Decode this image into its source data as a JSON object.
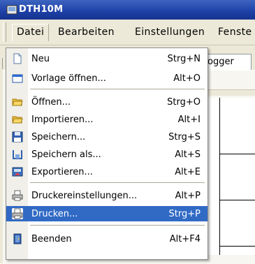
{
  "window": {
    "title": "DTH10M"
  },
  "menubar": {
    "items": [
      {
        "label": "Datei"
      },
      {
        "label": "Bearbeiten"
      },
      {
        "label": "Einstellungen"
      },
      {
        "label": "Fenste"
      }
    ]
  },
  "background": {
    "tab_label": "ogger"
  },
  "datei_menu": {
    "items": [
      {
        "label": "Neu",
        "shortcut": "Strg+N",
        "icon": "new-document-icon"
      },
      {
        "label": "Vorlage öffnen...",
        "shortcut": "Alt+O",
        "icon": "template-icon"
      },
      {
        "label": "Öffnen...",
        "shortcut": "Strg+O",
        "icon": "open-folder-icon"
      },
      {
        "label": "Importieren...",
        "shortcut": "Alt+I",
        "icon": "import-folder-icon"
      },
      {
        "label": "Speichern...",
        "shortcut": "Strg+S",
        "icon": "save-disk-icon"
      },
      {
        "label": "Speichern als...",
        "shortcut": "Alt+S",
        "icon": "save-as-icon"
      },
      {
        "label": "Exportieren...",
        "shortcut": "Alt+E",
        "icon": "export-icon"
      },
      {
        "label": "Druckereinstellungen...",
        "shortcut": "Alt+P",
        "icon": "printer-settings-icon"
      },
      {
        "label": "Drucken...",
        "shortcut": "Strg+P",
        "icon": "printer-icon",
        "highlighted": true
      },
      {
        "label": "Beenden",
        "shortcut": "Alt+F4",
        "icon": "exit-door-icon"
      }
    ]
  },
  "colors": {
    "titlebar": "#1d40a6",
    "highlight": "#316ac5",
    "menu_bg": "#ece9d8"
  }
}
